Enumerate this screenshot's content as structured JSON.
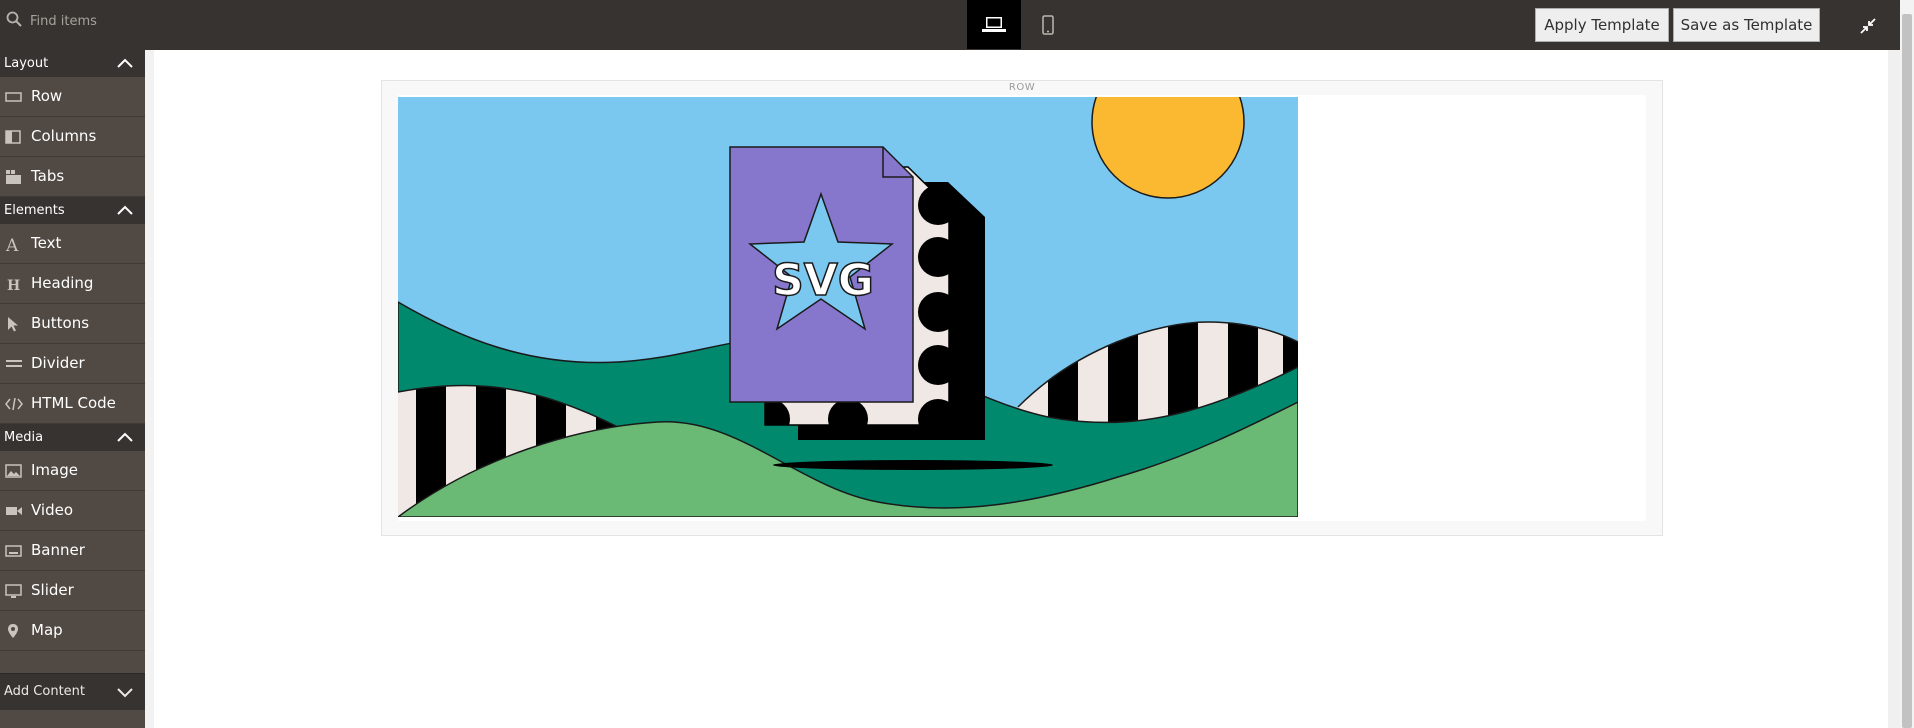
{
  "toolbar": {
    "search_placeholder": "Find items",
    "device_desktop": "desktop",
    "device_mobile": "mobile",
    "apply_template": "Apply Template",
    "save_as_template": "Save as Template"
  },
  "sidebar": {
    "sections": [
      {
        "label": "Layout",
        "items": [
          "Row",
          "Columns",
          "Tabs"
        ]
      },
      {
        "label": "Elements",
        "items": [
          "Text",
          "Heading",
          "Buttons",
          "Divider",
          "HTML Code"
        ]
      },
      {
        "label": "Media",
        "items": [
          "Image",
          "Video",
          "Banner",
          "Slider",
          "Map"
        ]
      }
    ],
    "add_content": "Add Content"
  },
  "stage": {
    "row_label": "ROW",
    "image_text": "SVG"
  },
  "colors": {
    "topbar": "#373330",
    "sidebar": "#514943",
    "sky": "#7ac7f0",
    "sun": "#fbb931",
    "hill_dark": "#00896d",
    "hill_light": "#6aba76",
    "file": "#8777cc"
  }
}
